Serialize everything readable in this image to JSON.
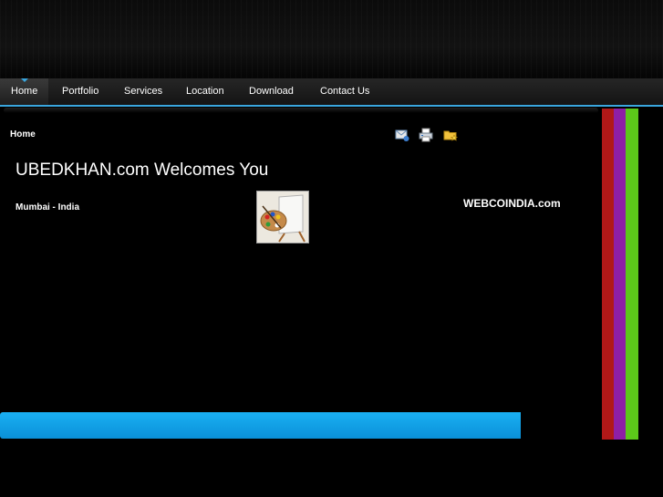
{
  "nav": {
    "items": [
      {
        "label": "Home",
        "active": true
      },
      {
        "label": "Portfolio"
      },
      {
        "label": "Services"
      },
      {
        "label": "Location"
      },
      {
        "label": "Download"
      },
      {
        "label": "Contact Us"
      }
    ]
  },
  "breadcrumb": "Home",
  "toolbar": {
    "icons": [
      "email-icon",
      "print-icon",
      "bookmark-folder-icon"
    ]
  },
  "main": {
    "title": "UBEDKHAN.com Welcomes You",
    "subtitle": "Mumbai - India",
    "brand": "WEBCOINDIA.com"
  },
  "colors": {
    "accent": "#3aa6de",
    "footer_bar": "#0a9be6",
    "stripe_red": "#b01818",
    "stripe_purple": "#8e1fa6",
    "stripe_green": "#5cc81a"
  }
}
